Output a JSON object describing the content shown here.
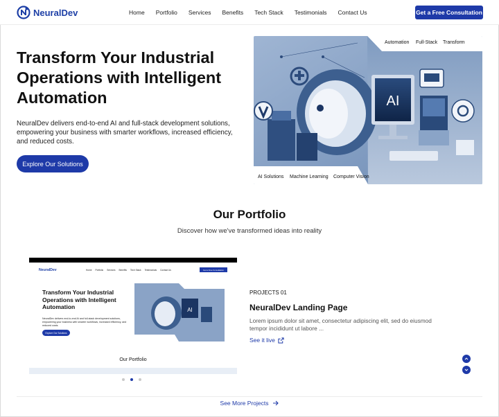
{
  "nav": {
    "brand": "NeuralDev",
    "links": [
      "Home",
      "Portfolio",
      "Services",
      "Benefits",
      "Tech Stack",
      "Testimonials",
      "Contact Us"
    ],
    "cta": "Get a Free Consultation"
  },
  "hero": {
    "title": "Transform Your Industrial Operations with Intelligent Automation",
    "description": "NeuralDev delivers end-to-end AI and full-stack development solutions, empowering your business with smarter workflows, increased efficiency, and reduced costs.",
    "button": "Explore Our Solutions",
    "image_tags_top": [
      "Automation",
      "Full-Stack",
      "Transform"
    ],
    "image_tags_bottom": [
      "AI Solutions",
      "Machine Learning",
      "Computer Vision"
    ],
    "screen_text": "AI"
  },
  "portfolio": {
    "title": "Our Portfolio",
    "subtitle": "Discover how we've transformed ideas into reality",
    "project_number": "PROJECTS 01",
    "project_title": "NeuralDev Landing Page",
    "project_description": "Lorem ipsum dolor sit amet, consectetur adipiscing elit, sed do eiusmod tempor incididunt ut labore ...",
    "project_link": "See it live",
    "carousel_dots": 3,
    "active_dot": 2,
    "thumbnail": {
      "brand": "NeuralDev",
      "links": [
        "Home",
        "Portfolio",
        "Services",
        "Benefits",
        "Tech Stack",
        "Testimonials",
        "Contact Us"
      ],
      "cta": "Get a Free Consultation",
      "title": "Transform Your Industrial Operations with Intelligent Automation",
      "description": "NeuralDev delivers end-to-end AI and full-stack development solutions, empowering your business with smarter workflows, increased efficiency, and reduced costs.",
      "button": "Explore Our Solutions",
      "section_title": "Our Portfolio",
      "screen_text": "AI"
    }
  },
  "footer": {
    "more_link": "See More Projects"
  },
  "colors": {
    "accent": "#1e3aa8",
    "image_bg": "#7f9bc0"
  }
}
